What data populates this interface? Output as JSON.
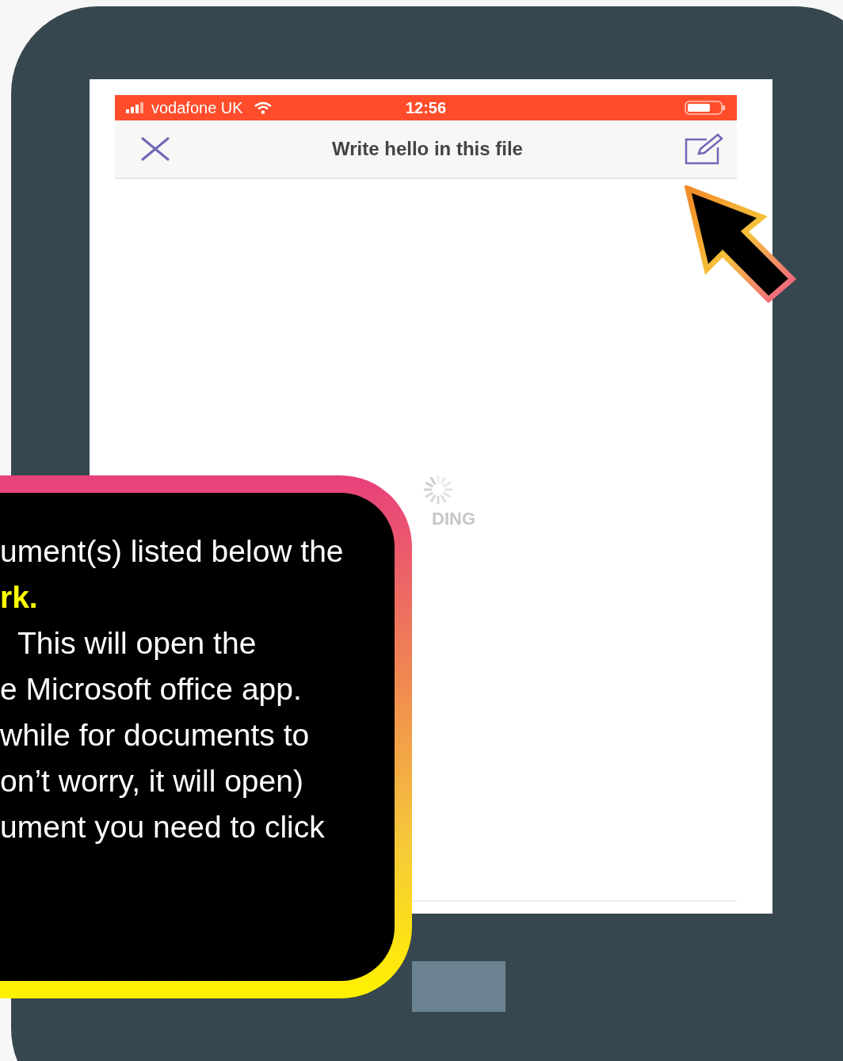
{
  "status_bar": {
    "carrier": "vodafone UK",
    "time": "12:56"
  },
  "nav_bar": {
    "title": "Write hello in this file"
  },
  "loading": {
    "label": "DING"
  },
  "callout": {
    "lines": [
      {
        "text": "ument(s) listed below the",
        "highlight": false
      },
      {
        "text": "rk.",
        "highlight": true
      },
      {
        "text": "This will open the",
        "highlight": false
      },
      {
        "text": "e Microsoft office app.",
        "highlight": false
      },
      {
        "text": "while for documents to",
        "highlight": false
      },
      {
        "text": "on’t worry, it will open)",
        "highlight": false
      },
      {
        "text": "ument you need to click",
        "highlight": false
      }
    ]
  }
}
